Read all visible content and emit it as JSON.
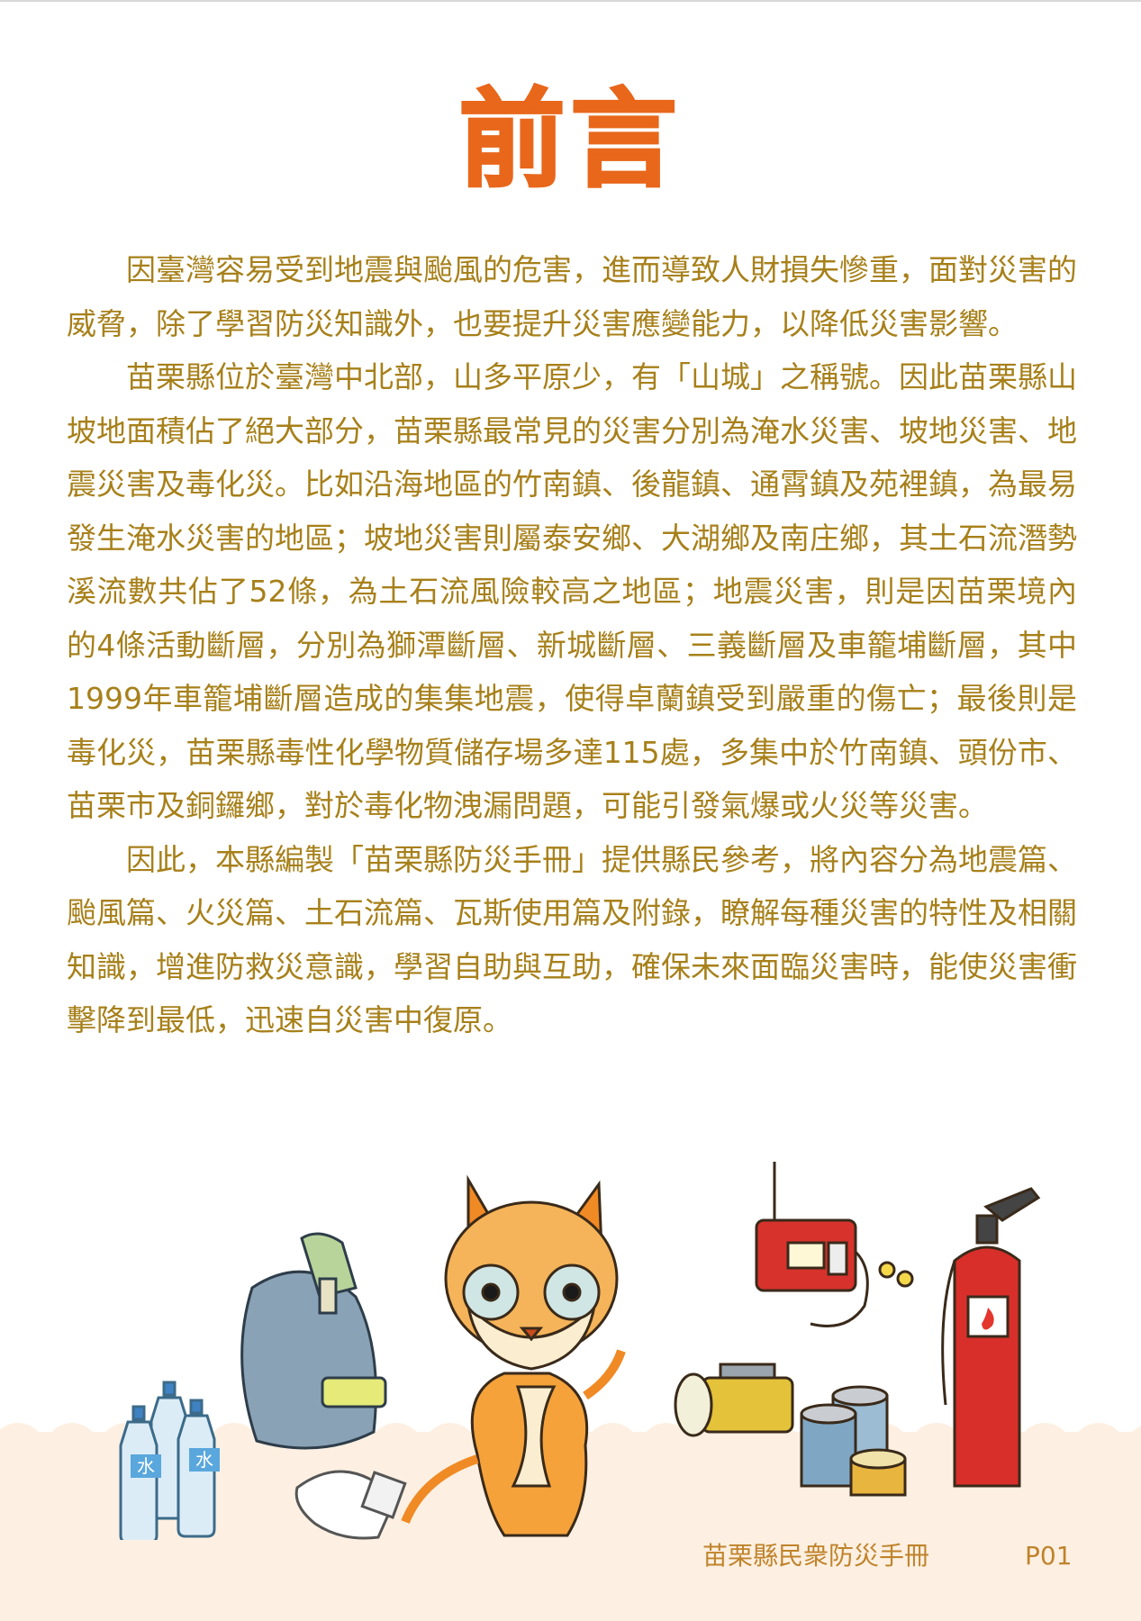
{
  "page": {
    "title": "前言",
    "paragraphs": [
      "因臺灣容易受到地震與颱風的危害，進而導致人財損失慘重，面對災害的威脅，除了學習防災知識外，也要提升災害應變能力，以降低災害影響。",
      "苗栗縣位於臺灣中北部，山多平原少，有「山城」之稱號。因此苗栗縣山坡地面積佔了絕大部分，苗栗縣最常見的災害分別為淹水災害、坡地災害、地震災害及毒化災。比如沿海地區的竹南鎮、後龍鎮、通霄鎮及苑裡鎮，為最易發生淹水災害的地區；坡地災害則屬泰安鄉、大湖鄉及南庄鄉，其土石流潛勢溪流數共佔了52條，為土石流風險較高之地區；地震災害，則是因苗栗境內的4條活動斷層，分別為獅潭斷層、新城斷層、三義斷層及車籠埔斷層，其中1999年車籠埔斷層造成的集集地震，使得卓蘭鎮受到嚴重的傷亡；最後則是毒化災，苗栗縣毒性化學物質儲存場多達115處，多集中於竹南鎮、頭份市、苗栗市及銅鑼鄉，對於毒化物洩漏問題，可能引發氣爆或火災等災害。",
      "因此，本縣編製「苗栗縣防災手冊」提供縣民參考，將內容分為地震篇、颱風篇、火災篇、土石流篇、瓦斯使用篇及附錄，瞭解每種災害的特性及相關知識，增進防救災意識，學習自助與互助，確保未來面臨災害時，能使災害衝擊降到最低，迅速自災害中復原。"
    ],
    "water_label": "水"
  },
  "footer": {
    "title": "苗栗縣民衆防災手冊",
    "page_number": "P01"
  },
  "colors": {
    "title": "#e8671b",
    "body_text": "#a7801a",
    "footer_text": "#c0832b",
    "band": "#fdf0e2"
  },
  "icons": [
    "water-bottle-icon",
    "backpack-icon",
    "gloves-icon",
    "cat-mascot-icon",
    "radio-icon",
    "flashlight-icon",
    "canned-food-icon",
    "fire-extinguisher-icon"
  ]
}
